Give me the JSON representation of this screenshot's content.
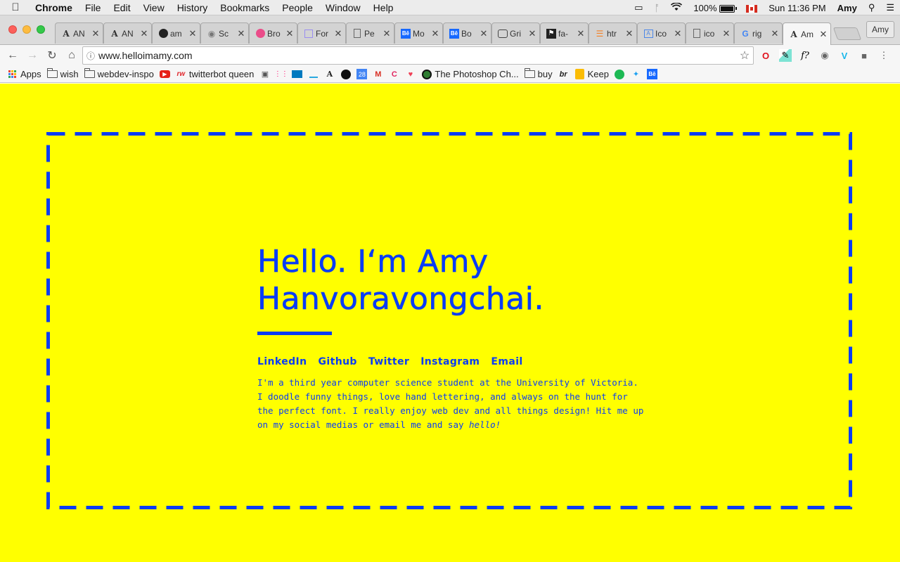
{
  "menubar": {
    "app": "Chrome",
    "items": [
      "File",
      "Edit",
      "View",
      "History",
      "Bookmarks",
      "People",
      "Window",
      "Help"
    ],
    "battery": "100%",
    "clock": "Sun 11:36 PM",
    "user": "Amy"
  },
  "tabs": [
    {
      "icon": "A",
      "title": "AN"
    },
    {
      "icon": "A",
      "title": "AN"
    },
    {
      "icon": "gh",
      "title": "am"
    },
    {
      "icon": "cam",
      "title": "Sc"
    },
    {
      "icon": "dr",
      "title": "Bro"
    },
    {
      "icon": "fo",
      "title": "For"
    },
    {
      "icon": "doc",
      "title": "Pe"
    },
    {
      "icon": "Bē",
      "title": "Mo"
    },
    {
      "icon": "Bē",
      "title": "Bo"
    },
    {
      "icon": "gr",
      "title": "Gri"
    },
    {
      "icon": "fa",
      "title": "fa-"
    },
    {
      "icon": "so",
      "title": "htr"
    },
    {
      "icon": "ic",
      "title": "Ico"
    },
    {
      "icon": "doc",
      "title": "ico"
    },
    {
      "icon": "G",
      "title": "rig"
    },
    {
      "icon": "A",
      "title": "Am",
      "active": true
    }
  ],
  "profile_button": "Amy",
  "address": {
    "url": "www.helloimamy.com"
  },
  "bookmarks": [
    {
      "icon": "apps",
      "label": "Apps"
    },
    {
      "icon": "folder",
      "label": "wish"
    },
    {
      "icon": "folder",
      "label": "webdev-inspo"
    },
    {
      "icon": "youtube",
      "label": ""
    },
    {
      "icon": "rw",
      "label": "twitterbot queen"
    },
    {
      "icon": "robot",
      "label": ""
    },
    {
      "icon": "dots",
      "label": ""
    },
    {
      "icon": "trello",
      "label": ""
    },
    {
      "icon": "line",
      "label": ""
    },
    {
      "icon": "A",
      "label": ""
    },
    {
      "icon": "nike",
      "label": ""
    },
    {
      "icon": "calendar",
      "label": ""
    },
    {
      "icon": "gmail",
      "label": ""
    },
    {
      "icon": "c",
      "label": ""
    },
    {
      "icon": "pocket",
      "label": ""
    },
    {
      "icon": "ps",
      "label": "The Photoshop Ch..."
    },
    {
      "icon": "folder",
      "label": "buy"
    },
    {
      "icon": "br",
      "label": ""
    },
    {
      "icon": "keep",
      "label": "Keep"
    },
    {
      "icon": "spotify",
      "label": ""
    },
    {
      "icon": "twitter",
      "label": ""
    },
    {
      "icon": "behance",
      "label": ""
    }
  ],
  "hero": {
    "line1": "Hello. I‘m Amy",
    "line2": "Hanvoravongchai.",
    "links": [
      "LinkedIn",
      "Github",
      "Twitter",
      "Instagram",
      "Email"
    ],
    "bio": "I'm a third year computer science student at the University of Victoria. I doodle funny things, love hand lettering, and always on the hunt for the perfect font. I really enjoy web dev and all things design! Hit me up on my social medias or email me and say ",
    "bio_em": "hello!"
  },
  "colors": {
    "page_bg": "#ffff00",
    "accent": "#0a3cf5"
  }
}
